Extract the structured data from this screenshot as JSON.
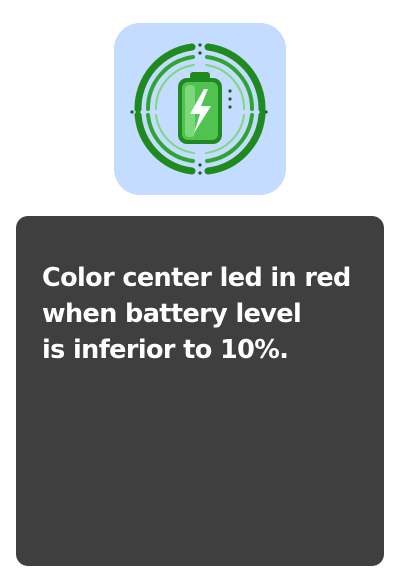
{
  "icon": {
    "name": "battery-charging-icon",
    "background_color": "#c3dcff",
    "ring_color": "#1f8a1f",
    "battery_color": "#3fb23f",
    "bolt_color": "#ffffff"
  },
  "card": {
    "background_color": "#3f3f3f",
    "text_color": "#ffffff",
    "message": "Color center led in red\nwhen battery level\nis inferior to 10%."
  }
}
